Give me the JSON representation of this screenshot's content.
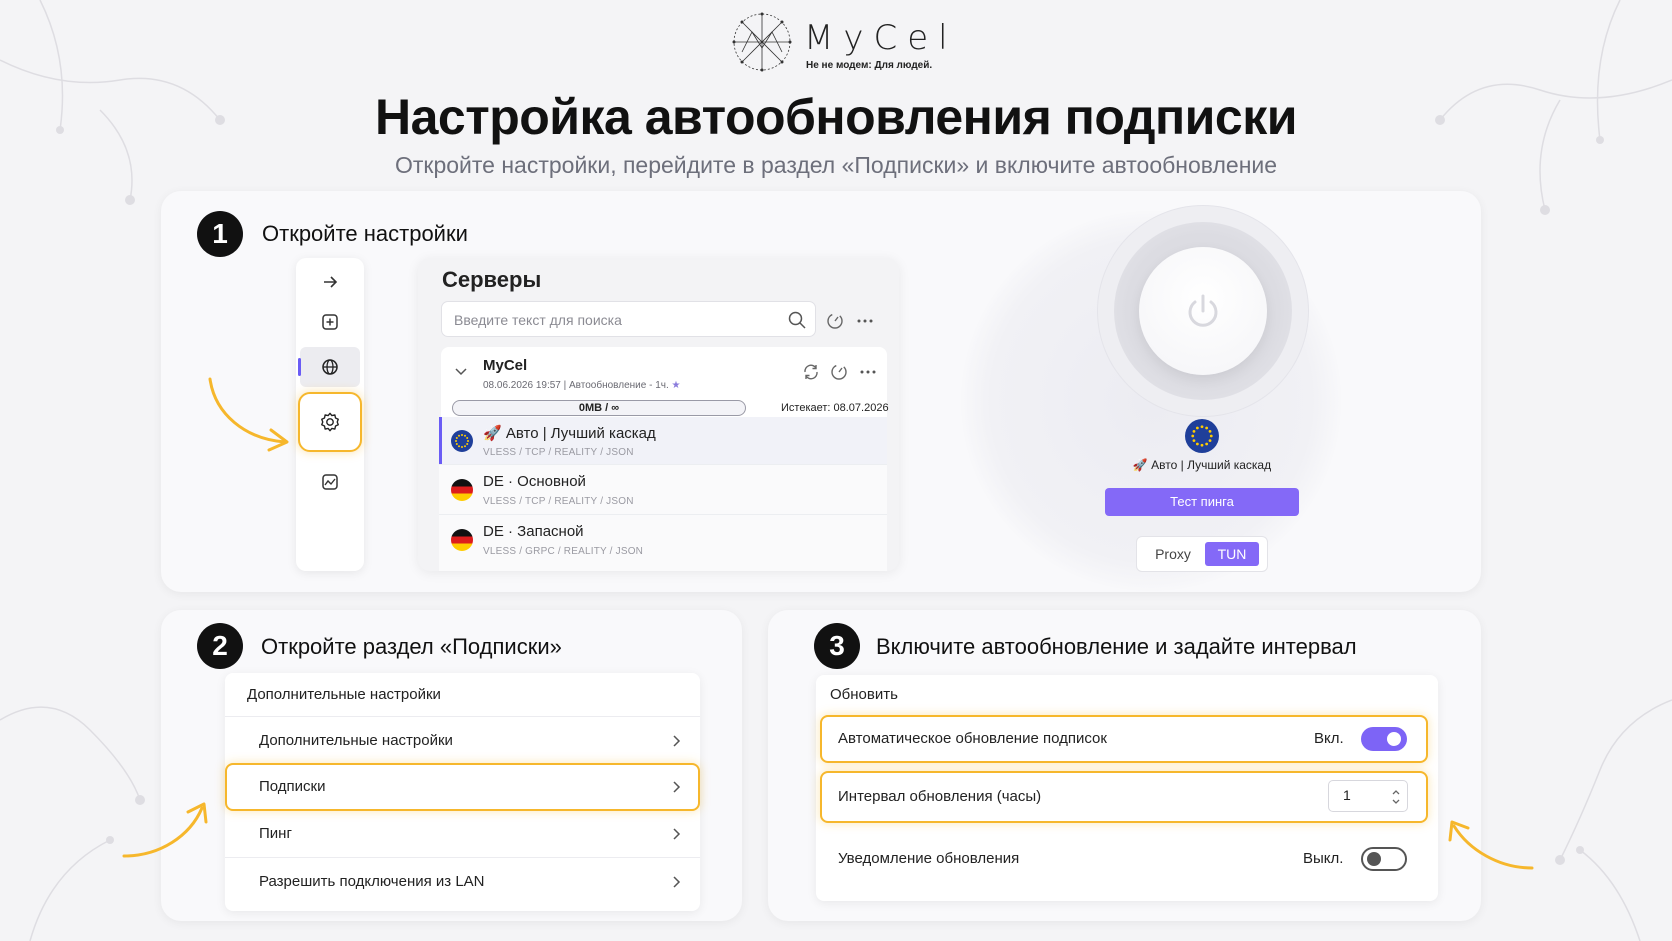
{
  "brand": {
    "name": "MyCel",
    "tagline": "Не не модем: Для людей."
  },
  "header": {
    "title": "Настройка автообновления подписки",
    "subtitle": "Откройте настройки, перейдите в раздел «Подписки» и включите автообновление"
  },
  "step1": {
    "number": "1",
    "title": "Откройте настройки",
    "sidebar": {
      "icons": [
        "arrow-right-icon",
        "plus-square-icon",
        "globe-icon",
        "gear-icon",
        "chart-icon"
      ],
      "active": "globe-icon",
      "highlighted": "gear-icon"
    },
    "servers": {
      "title": "Серверы",
      "search_placeholder": "Введите текст для поиска",
      "subscription": {
        "name": "MyCel",
        "meta": "08.06.2026 19:57 | Автообновление - 1ч.",
        "traffic": "0MB / ∞",
        "expires": "Истекает: 08.07.2026"
      },
      "rows": [
        {
          "name": "🚀 Авто | Лучший каскад",
          "proto": "VLESS / TCP / REALITY / JSON",
          "flag": "eu",
          "selected": true
        },
        {
          "name": "DE · Основной",
          "proto": "VLESS / TCP / REALITY / JSON",
          "flag": "de",
          "selected": false
        },
        {
          "name": "DE · Запасной",
          "proto": "VLESS / GRPC / REALITY / JSON",
          "flag": "de",
          "selected": false
        }
      ]
    },
    "connect": {
      "server": "🚀 Авто | Лучший каскад",
      "ping_button": "Тест пинга",
      "modes": [
        "Proxy",
        "TUN"
      ],
      "active_mode": "TUN"
    }
  },
  "step2": {
    "number": "2",
    "title": "Откройте раздел «Подписки»",
    "panel_title": "Дополнительные настройки",
    "items": [
      {
        "label": "Дополнительные настройки"
      },
      {
        "label": "Подписки",
        "highlighted": true
      },
      {
        "label": "Пинг"
      },
      {
        "label": "Разрешить подключения из LAN"
      }
    ]
  },
  "step3": {
    "number": "3",
    "title": "Включите автообновление и задайте интервал",
    "panel_title": "Обновить",
    "auto_update": {
      "label": "Автоматическое обновление подписок",
      "state": "Вкл.",
      "on": true
    },
    "interval": {
      "label": "Интервал обновления (часы)",
      "value": "1"
    },
    "notify": {
      "label": "Уведомление обновления",
      "state": "Выкл.",
      "on": false
    }
  },
  "colors": {
    "accent": "#7d64f6",
    "highlight": "#f6b72c",
    "background": "#f4f4f6"
  }
}
